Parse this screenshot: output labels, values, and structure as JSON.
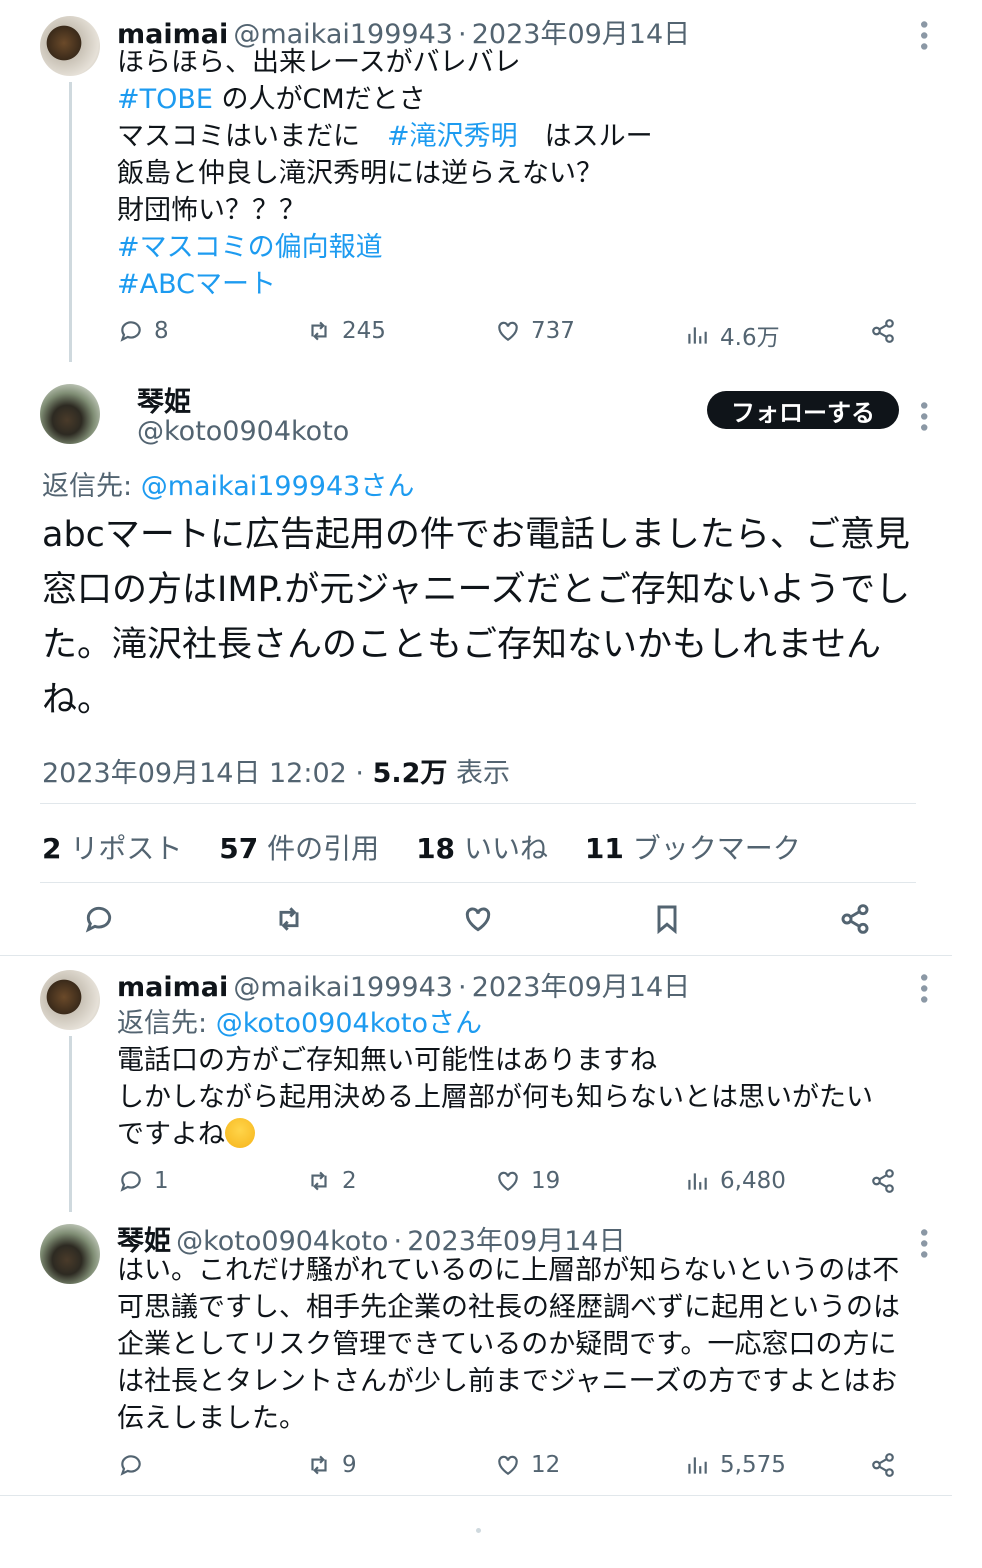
{
  "tweet1": {
    "name": "maimai",
    "handle": "@maikai199943",
    "sep": "·",
    "date": "2023年09月14日",
    "lines": {
      "l1": "ほらほら、出来レースがバレバレ",
      "l2_link": "#TOBE",
      "l2_text": " の人がCMだとさ",
      "l3_text": "マスコミはいまだに　",
      "l3_link": "#滝沢秀明",
      "l3_tail": "　はスルー",
      "l4": "飯島と仲良し滝沢秀明には逆らえない？",
      "l5": "財団怖い？？？",
      "l6_link": "#マスコミの偏向報道",
      "l7_link": "#ABCマート"
    },
    "stats": {
      "replies": "8",
      "reposts": "245",
      "likes": "737",
      "views": "4.6万"
    }
  },
  "main": {
    "name": "琴姫",
    "handle": "@koto0904koto",
    "follow_label": "フォローする",
    "reply_prefix": "返信先: ",
    "reply_to": "@maikai199943さん",
    "text": "abcマートに広告起用の件でお電話しましたら、ご意見窓口の方はIMP.が元ジャニーズだとご存知ないようでした。滝沢社長さんのこともご存知ないかもしれませんね。",
    "timestamp": "2023年09月14日 12:02 · ",
    "views_num": "5.2万",
    "views_label": " 表示",
    "reposts_num": "2",
    "reposts_label": " リポスト",
    "quotes_num": "57",
    "quotes_label": " 件の引用",
    "likes_num": "18",
    "likes_label": " いいね",
    "bookmarks_num": "11",
    "bookmarks_label": " ブックマーク"
  },
  "reply1": {
    "name": "maimai",
    "handle": "@maikai199943",
    "sep": "·",
    "date": "2023年09月14日",
    "reply_prefix": "返信先: ",
    "reply_to": "@koto0904kotoさん",
    "l1": "電話口の方がご存知無い可能性はありますね",
    "l2": "しかしながら起用決める上層部が何も知らないとは思いがたい",
    "l3": "ですよね",
    "stats": {
      "replies": "1",
      "reposts": "2",
      "likes": "19",
      "views": "6,480"
    }
  },
  "reply2": {
    "name": "琴姫",
    "handle": "@koto0904koto",
    "sep": "·",
    "date": "2023年09月14日",
    "text": "はい。これだけ騒がれているのに上層部が知らないというのは不可思議ですし、相手先企業の社長の経歴調べずに起用というのは企業としてリスク管理できているのか疑問です。一応窓口の方には社長とタレントさんが少し前までジャニーズの方ですよとはお伝えしました。",
    "stats": {
      "reposts": "9",
      "likes": "12",
      "views": "5,575"
    }
  },
  "colors": {
    "link": "#1d9bf0",
    "muted": "#536471",
    "text": "#0f1419"
  }
}
